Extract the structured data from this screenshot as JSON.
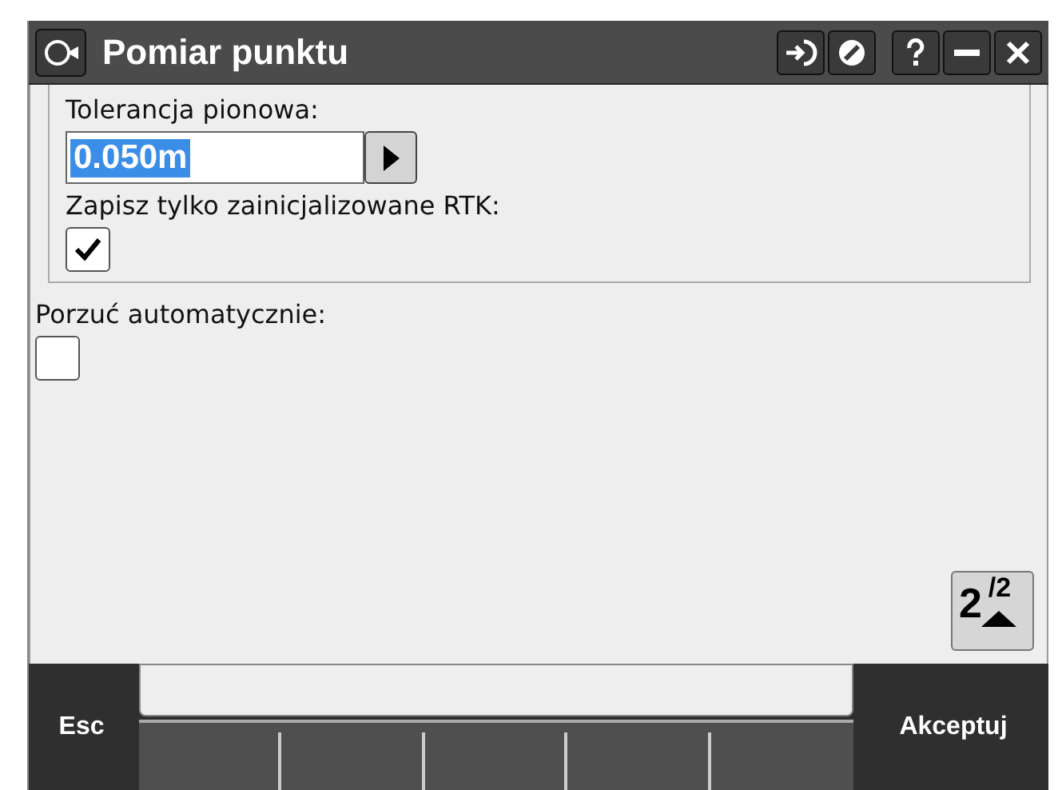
{
  "window": {
    "title": "Pomiar punktu"
  },
  "group": {
    "tolerance_label": "Tolerancja pionowa:",
    "tolerance_value": "0.050m",
    "rtk_label": "Zapisz tylko zainicjalizowane RTK:",
    "rtk_checked": true
  },
  "auto_abandon": {
    "label": "Porzuć automatycznie:",
    "checked": false
  },
  "page": {
    "current": "2",
    "separator": "/",
    "total": "2"
  },
  "softkeys": {
    "left": "Esc",
    "right": "Akceptuj"
  }
}
